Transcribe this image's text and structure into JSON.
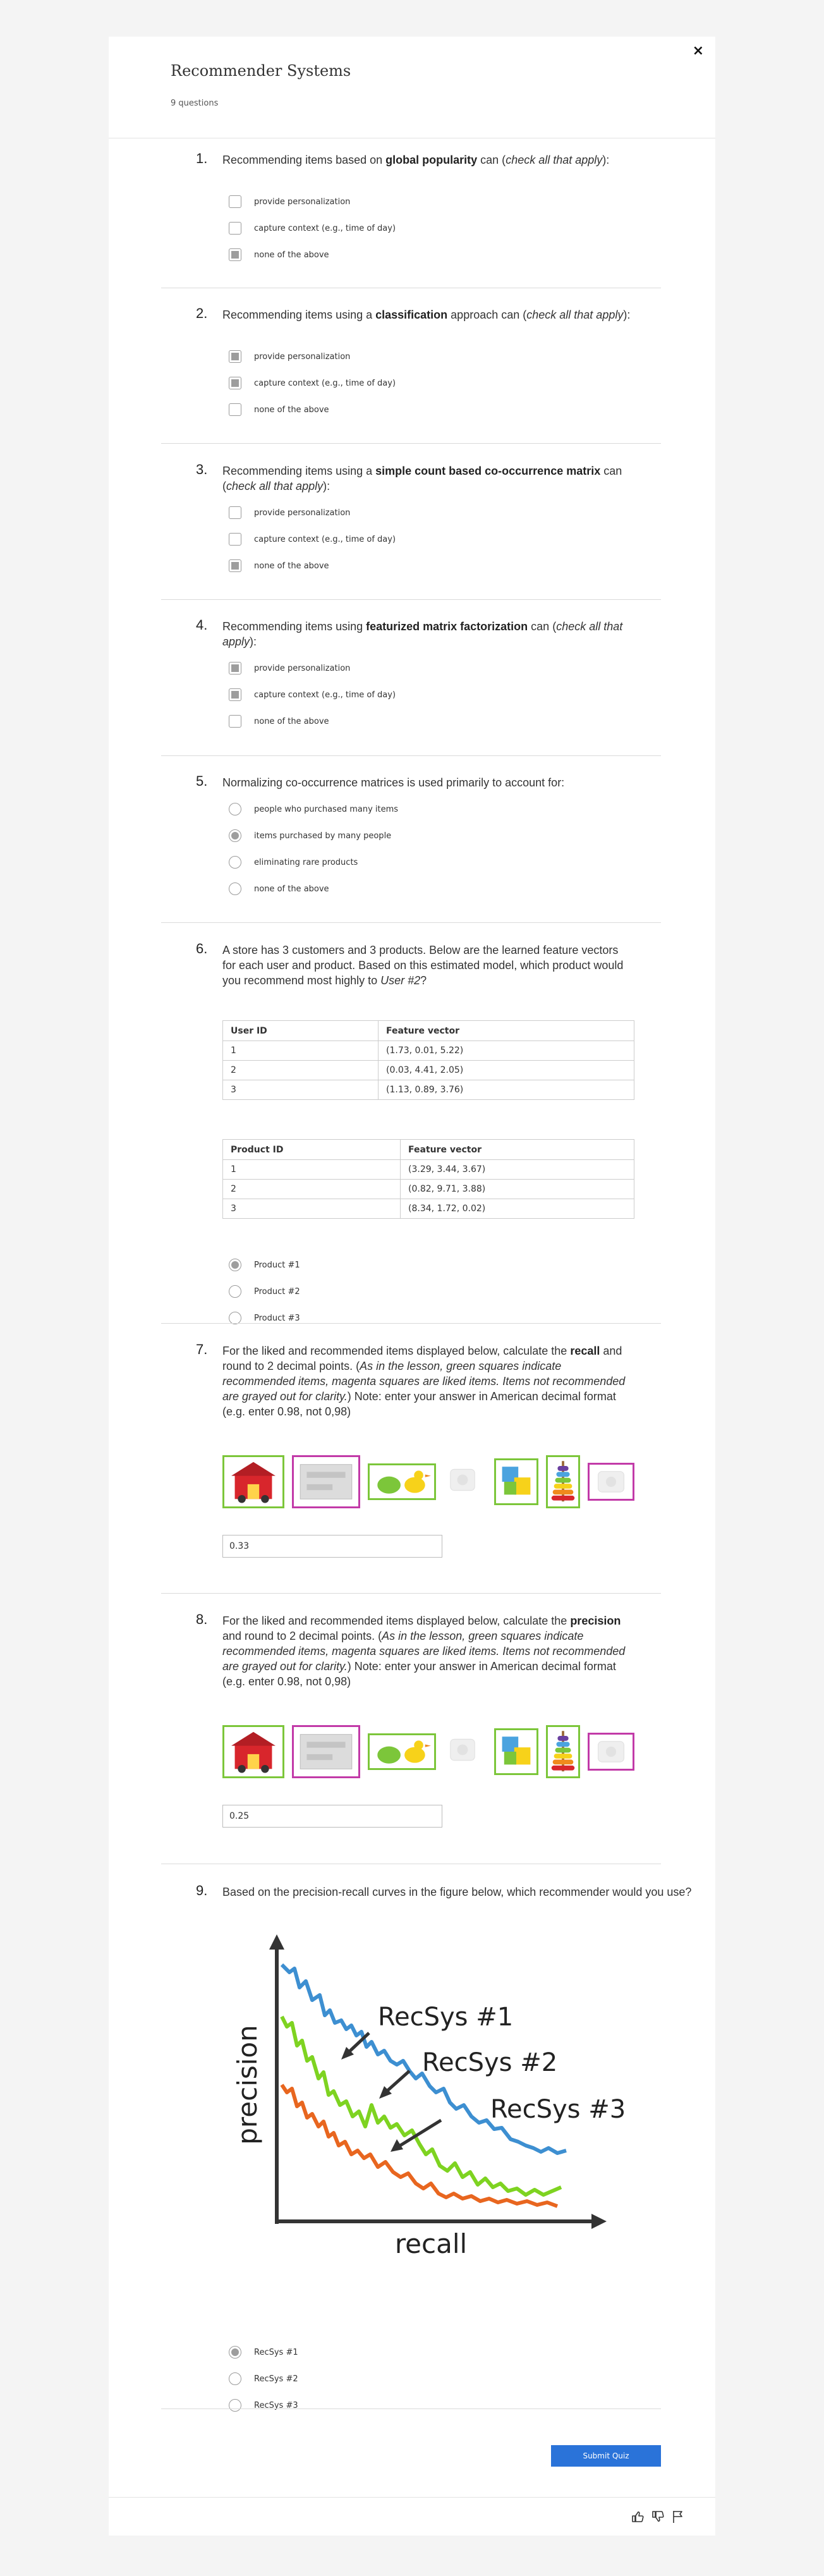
{
  "quiz": {
    "title": "Recommender Systems",
    "question_count": "9 questions",
    "close_icon": "×",
    "submit_label": "Submit Quiz"
  },
  "questions": [
    {
      "number": "1.",
      "type": "checkbox",
      "text_parts": [
        "Recommending items based on ",
        "global popularity",
        " can (",
        "check all that apply",
        "):"
      ],
      "options": [
        {
          "label": "provide personalization",
          "selected": false
        },
        {
          "label": "capture context (e.g., time of day)",
          "selected": false
        },
        {
          "label": "none of the above",
          "selected": true
        }
      ]
    },
    {
      "number": "2.",
      "type": "checkbox",
      "text_parts": [
        "Recommending items using a ",
        "classification",
        " approach can (",
        "check all that apply",
        "):"
      ],
      "options": [
        {
          "label": "provide personalization",
          "selected": true
        },
        {
          "label": "capture context (e.g., time of day)",
          "selected": true
        },
        {
          "label": "none of the above",
          "selected": false
        }
      ]
    },
    {
      "number": "3.",
      "type": "checkbox",
      "text_parts": [
        "Recommending items using a ",
        "simple count based co-occurrence matrix",
        " can (",
        "check all that apply",
        "):"
      ],
      "options": [
        {
          "label": "provide personalization",
          "selected": false
        },
        {
          "label": "capture context (e.g., time of day)",
          "selected": false
        },
        {
          "label": "none of the above",
          "selected": true
        }
      ]
    },
    {
      "number": "4.",
      "type": "checkbox",
      "text_parts": [
        "Recommending items using ",
        "featurized matrix factorization",
        " can (",
        "check all that apply",
        "):"
      ],
      "options": [
        {
          "label": "provide personalization",
          "selected": true
        },
        {
          "label": "capture context (e.g., time of day)",
          "selected": true
        },
        {
          "label": "none of the above",
          "selected": false
        }
      ]
    },
    {
      "number": "5.",
      "type": "radio",
      "text": "Normalizing co-occurrence matrices is used primarily to account for:",
      "options": [
        {
          "label": "people who purchased many items",
          "selected": false
        },
        {
          "label": "items purchased by many people",
          "selected": true
        },
        {
          "label": "eliminating rare products",
          "selected": false
        },
        {
          "label": "none of the above",
          "selected": false
        }
      ]
    },
    {
      "number": "6.",
      "type": "radio",
      "text_parts": [
        "A store has 3 customers and 3 products. Below are the learned feature vectors for each user and product. Based on this estimated model, which product would you recommend most highly to ",
        "User #2",
        "?"
      ],
      "user_table": {
        "headers": [
          "User ID",
          "Feature vector"
        ],
        "rows": [
          [
            "1",
            "(1.73, 0.01, 5.22)"
          ],
          [
            "2",
            "(0.03, 4.41, 2.05)"
          ],
          [
            "3",
            "(1.13, 0.89, 3.76)"
          ]
        ]
      },
      "product_table": {
        "headers": [
          "Product ID",
          "Feature vector"
        ],
        "rows": [
          [
            "1",
            "(3.29, 3.44, 3.67)"
          ],
          [
            "2",
            "(0.82, 9.71, 3.88)"
          ],
          [
            "3",
            "(8.34, 1.72, 0.02)"
          ]
        ]
      },
      "options": [
        {
          "label": "Product #1",
          "selected": true
        },
        {
          "label": "Product #2",
          "selected": false
        },
        {
          "label": "Product #3",
          "selected": false
        }
      ]
    },
    {
      "number": "7.",
      "type": "text",
      "text_parts": [
        "For the liked and recommended items displayed below, calculate the ",
        "recall",
        " and round to 2 decimal points. (",
        "As in the lesson, green squares indicate recommended items, magenta squares are liked items. Items not recommended are grayed out for clarity.",
        ") Note: enter your answer in American decimal format (e.g. enter 0.98, not 0,98)"
      ],
      "answer": "0.33"
    },
    {
      "number": "8.",
      "type": "text",
      "text_parts": [
        "For the liked and recommended items displayed below, calculate the ",
        "precision",
        " and round to 2 decimal points. (",
        "As in the lesson, green squares indicate recommended items, magenta squares are liked items. Items not recommended are grayed out for clarity.",
        ") Note: enter your answer in American decimal format (e.g. enter 0.98, not 0,98)"
      ],
      "answer": "0.25"
    },
    {
      "number": "9.",
      "type": "radio",
      "text": "Based on the precision-recall curves in the figure below, which recommender would you use?",
      "figure": {
        "y_label": "precision",
        "x_label": "recall",
        "labels": [
          "RecSys #1",
          "RecSys #2",
          "RecSys #3"
        ],
        "colors": [
          "#3d8fd1",
          "#7ed321",
          "#e8661f"
        ]
      },
      "options": [
        {
          "label": "RecSys #1",
          "selected": true
        },
        {
          "label": "RecSys #2",
          "selected": false
        },
        {
          "label": "RecSys #3",
          "selected": false
        }
      ]
    }
  ],
  "item_strip": [
    {
      "name": "barn-toy",
      "frame": "green"
    },
    {
      "name": "gray-item",
      "frame": "magenta"
    },
    {
      "name": "duck-toy",
      "frame": "green"
    },
    {
      "name": "faded-item",
      "frame": "none"
    },
    {
      "name": "blocks-toy",
      "frame": "green"
    },
    {
      "name": "ring-stacker-toy",
      "frame": "green"
    },
    {
      "name": "faded-item",
      "frame": "magenta"
    }
  ],
  "footer_icons": [
    "thumbs-up-icon",
    "thumbs-down-icon",
    "flag-icon"
  ]
}
